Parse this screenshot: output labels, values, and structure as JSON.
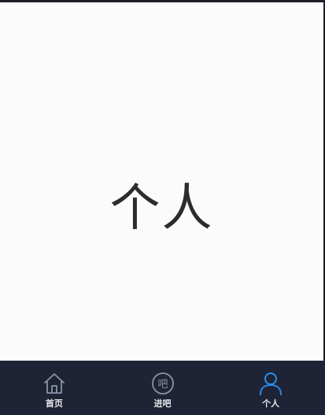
{
  "page": {
    "title": "个人"
  },
  "nav": {
    "items": [
      {
        "label": "首页",
        "icon": "home-icon",
        "active": false
      },
      {
        "label": "进吧",
        "icon": "chat-bubble-icon",
        "active": false
      },
      {
        "label": "个人",
        "icon": "person-icon",
        "active": true
      }
    ],
    "icon_glyph_chat": "吧"
  },
  "colors": {
    "background": "#fbfbfb",
    "nav_background": "#1e2435",
    "inactive_icon": "#8a93a6",
    "active_icon": "#2a8be8",
    "label": "#e8e8ec",
    "title_text": "#2c2c2c"
  }
}
